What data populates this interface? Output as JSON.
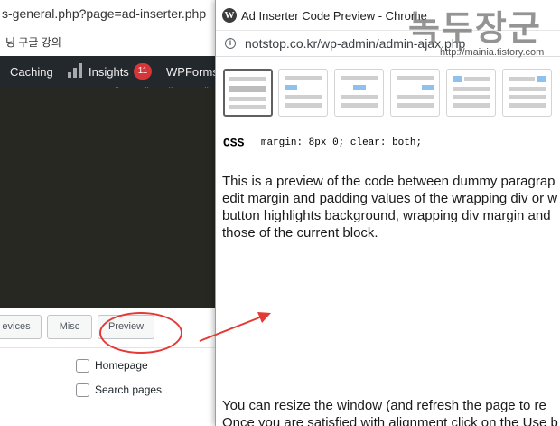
{
  "background_window": {
    "url_fragment": "s-general.php?page=ad-inserter.php",
    "bookmark_fragment": "닝 구글 강의",
    "admin_bar": {
      "caching_label": "Caching",
      "insights_label": "Insights",
      "insights_badge": "11",
      "wpforms_label": "WPForms"
    },
    "tabs": {
      "devices_label": "evices",
      "misc_label": "Misc",
      "preview_label": "Preview"
    },
    "checkboxes": [
      {
        "label": "Homepage",
        "checked": false
      },
      {
        "label": "Search pages",
        "checked": false
      }
    ],
    "code_colors": {
      "background": "#272822",
      "string": "#e6db74"
    }
  },
  "annotation": {
    "color": "#e53935"
  },
  "preview_window": {
    "title": "Ad Inserter Code Preview - Chrome",
    "url": "notstop.co.kr/wp-admin/admin-ajax.php",
    "css_label": "CSS",
    "css_code": "margin: 8px 0; clear: both;",
    "paragraph1": [
      "This is a preview of the code between dummy paragrap",
      "edit margin and padding values of the wrapping div or w",
      "button highlights background, wrapping div margin and",
      "those of the current block."
    ],
    "paragraph2": [
      "You can resize the window (and refresh the page to re",
      "Once you are satisfied with alignment click on the Use b"
    ],
    "thumbnails": [
      {
        "name": "default",
        "selected": true
      },
      {
        "name": "left",
        "selected": false
      },
      {
        "name": "center",
        "selected": false
      },
      {
        "name": "right",
        "selected": false
      },
      {
        "name": "float-left",
        "selected": false
      },
      {
        "name": "float-right",
        "selected": false
      }
    ]
  },
  "watermark": {
    "text": "녹두장군",
    "url": "http://mainia.tistory.com"
  }
}
